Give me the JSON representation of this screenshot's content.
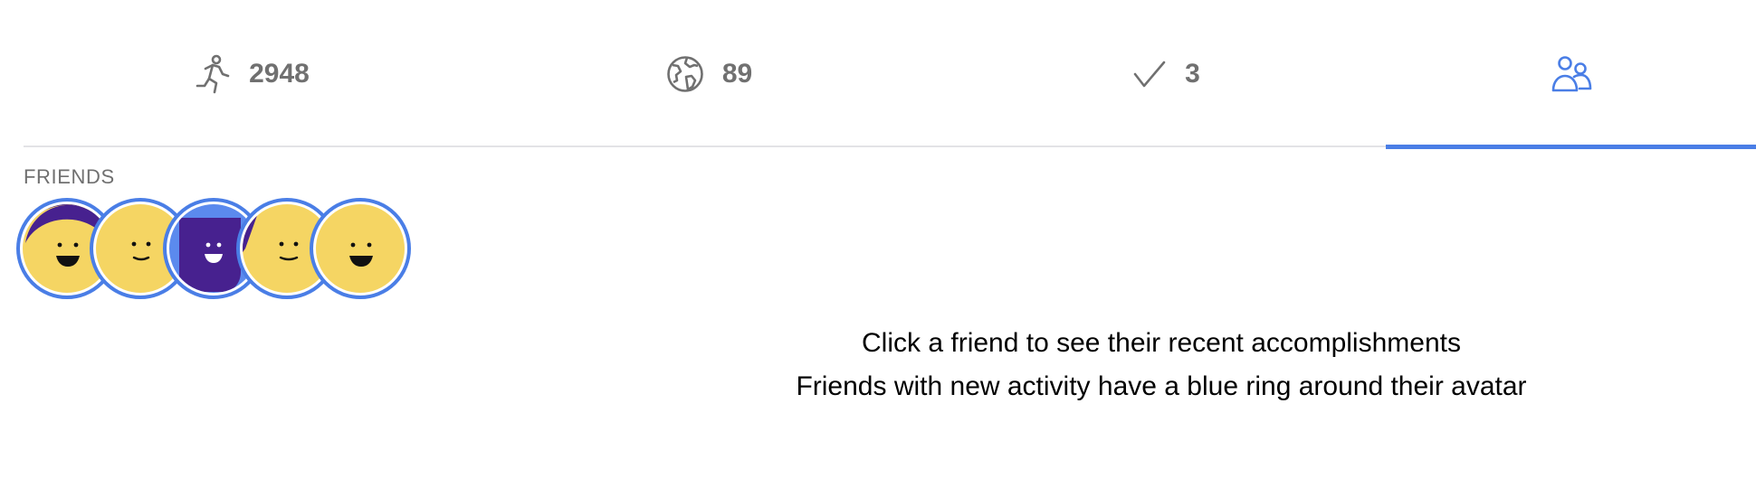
{
  "tabs": [
    {
      "id": "activity",
      "icon": "running-person-icon",
      "count": "2948",
      "active": false
    },
    {
      "id": "globe",
      "icon": "globe-icon",
      "count": "89",
      "active": false
    },
    {
      "id": "completed",
      "icon": "checkmark-icon",
      "count": "3",
      "active": false
    },
    {
      "id": "friends",
      "icon": "people-icon",
      "count": "",
      "active": true
    }
  ],
  "friends_section": {
    "label": "FRIENDS",
    "avatars": [
      {
        "style": "yellow-face-purple-cap",
        "ring_color": "#4a7ee6"
      },
      {
        "style": "yellow-face-small-smile",
        "ring_color": "#4a7ee6"
      },
      {
        "style": "purple-square-face",
        "ring_color": "#4a7ee6"
      },
      {
        "style": "yellow-face-purple-wedge",
        "ring_color": "#4a7ee6"
      },
      {
        "style": "yellow-face-big-smile",
        "ring_color": "#4a7ee6"
      }
    ]
  },
  "hint": {
    "line1": "Click a friend to see their recent accomplishments",
    "line2": "Friends with new activity have a blue ring around their avatar"
  },
  "colors": {
    "accent": "#4a7ee6",
    "avatar_yellow": "#f5d563",
    "avatar_purple": "#47218f",
    "muted_text": "#707070"
  }
}
